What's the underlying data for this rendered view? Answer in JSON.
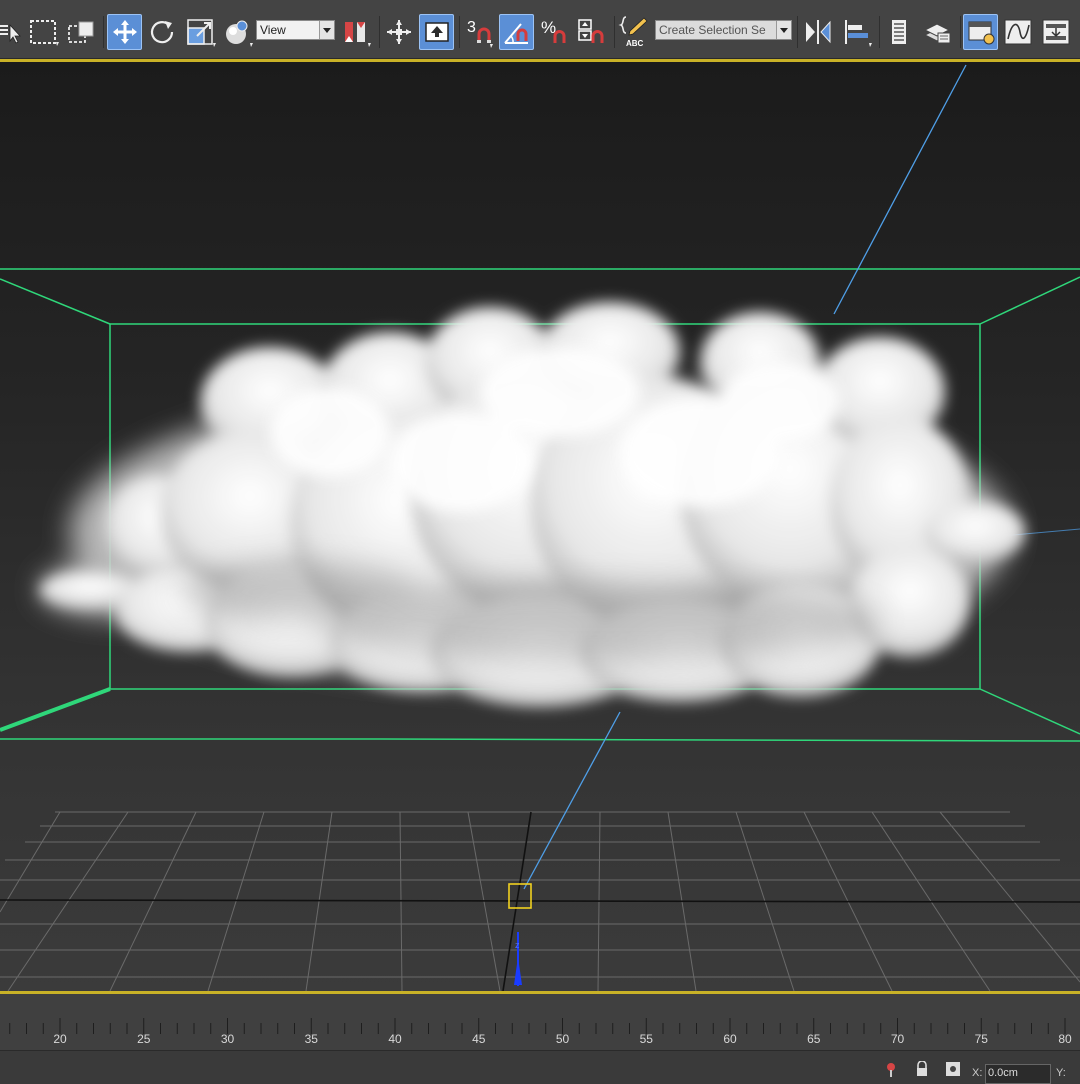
{
  "toolbar": {
    "ref_coord_system": "View",
    "snap_toggle_label": "3",
    "percent_snap_label": "%",
    "named_selection_set_placeholder": "Create Selection Se",
    "edit_named_sets_label": "ABC"
  },
  "viewport": {
    "axis_label": "z"
  },
  "timeline": {
    "ticks": [
      "20",
      "25",
      "30",
      "35",
      "40",
      "45",
      "50",
      "55",
      "60",
      "65",
      "70",
      "75",
      "80"
    ]
  },
  "statusbar": {
    "x_label": "X:",
    "x_value": "0.0cm",
    "y_label": "Y:"
  },
  "colors": {
    "active_button": "#5b8fd6",
    "viewport_border": "#c9b227",
    "container_box": "#2fd77a",
    "camera_line": "#4f9fe8",
    "grid": "#6a6a6a"
  }
}
